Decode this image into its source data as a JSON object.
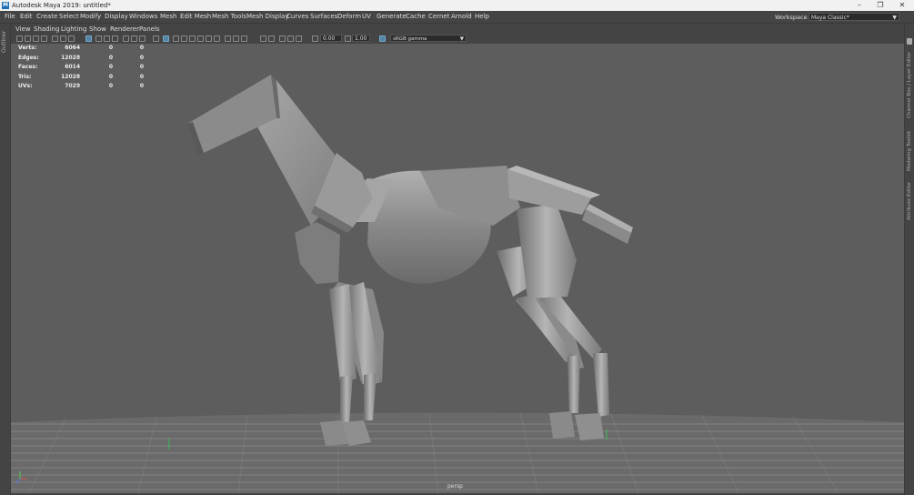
{
  "window": {
    "title": "Autodesk Maya 2019: untitled*",
    "logo": "M",
    "minimize": "–",
    "restore": "❐",
    "close": "✕"
  },
  "menubar": {
    "items": [
      "File",
      "Edit",
      "Create",
      "Select",
      "Modify",
      "Display",
      "Windows",
      "Mesh",
      "Edit Mesh",
      "Mesh Tools",
      "Mesh Display",
      "Curves",
      "Surfaces",
      "Deform",
      "UV",
      "Generate",
      "Cache",
      "Cernet",
      "Arnold",
      "Help"
    ],
    "workspace_label": "Workspace :",
    "workspace_value": "Maya Classic*"
  },
  "left_panel": {
    "label": "Outliner"
  },
  "right_panel": {
    "labels": [
      "Channel Box / Layer Editor",
      "Modeling Toolkit",
      "Attribute Editor"
    ]
  },
  "panel_menu": [
    "View",
    "Shading",
    "Lighting",
    "Show",
    "Renderer",
    "Panels"
  ],
  "toolbar": {
    "exposure_value": "0.00",
    "gamma_value": "1.00",
    "color_space": "sRGB gamma"
  },
  "hud": {
    "rows": [
      {
        "label": "Verts:",
        "v1": "6064",
        "v2": "0",
        "v3": "0"
      },
      {
        "label": "Edges:",
        "v1": "12028",
        "v2": "0",
        "v3": "0"
      },
      {
        "label": "Faces:",
        "v1": "6014",
        "v2": "0",
        "v3": "0"
      },
      {
        "label": "Tris:",
        "v1": "12028",
        "v2": "0",
        "v3": "0"
      },
      {
        "label": "UVs:",
        "v1": "7029",
        "v2": "0",
        "v3": "0"
      }
    ]
  },
  "viewport": {
    "camera": "persp",
    "background_color": "#5d5d5d",
    "grid_color": "#aaaaaa",
    "model_color": "#9a9a9a"
  }
}
